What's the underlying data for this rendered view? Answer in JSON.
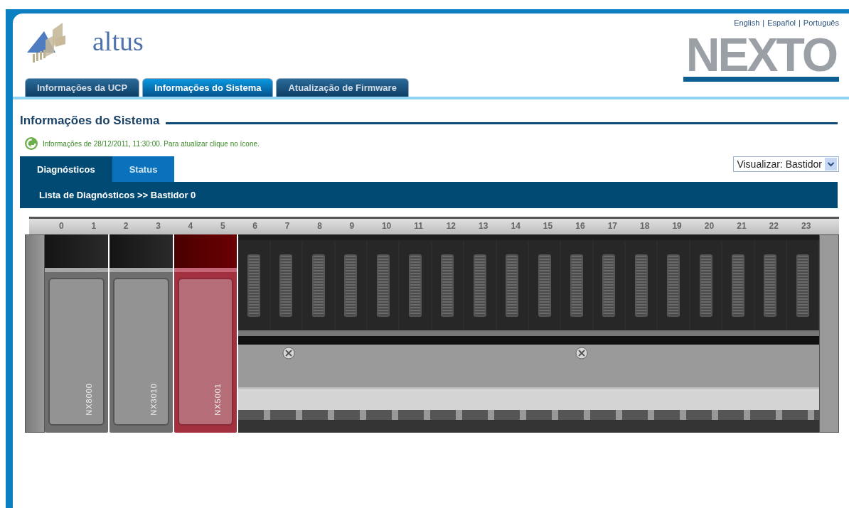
{
  "header": {
    "brand": "altus",
    "languages": [
      "English",
      "Español",
      "Português"
    ],
    "language_separator": "|",
    "product_logo": "NEXTO"
  },
  "main_tabs": [
    {
      "label": "Informações da UCP",
      "selected": false
    },
    {
      "label": "Informações do Sistema",
      "selected": true
    },
    {
      "label": "Atualização de Firmware",
      "selected": false
    }
  ],
  "section_title": "Informações do Sistema",
  "info_message": "Informações de 28/12/2011, 11:30:00. Para atualizar clique no ícone.",
  "view_select": {
    "value": "Visualizar: Bastidor"
  },
  "sub_tabs": [
    {
      "label": "Diagnósticos",
      "selected": true
    },
    {
      "label": "Status",
      "selected": false
    }
  ],
  "breadcrumb": "Lista de Diagnósticos >> Bastidor 0",
  "rack": {
    "positions": [
      "0",
      "1",
      "2",
      "3",
      "4",
      "5",
      "6",
      "7",
      "8",
      "9",
      "10",
      "11",
      "12",
      "13",
      "14",
      "15",
      "16",
      "17",
      "18",
      "19",
      "20",
      "21",
      "22",
      "23"
    ],
    "modules": [
      {
        "name": "NX8000",
        "alarm": false
      },
      {
        "name": "NX3010",
        "alarm": false
      },
      {
        "name": "NX5001",
        "alarm": true
      }
    ]
  }
}
